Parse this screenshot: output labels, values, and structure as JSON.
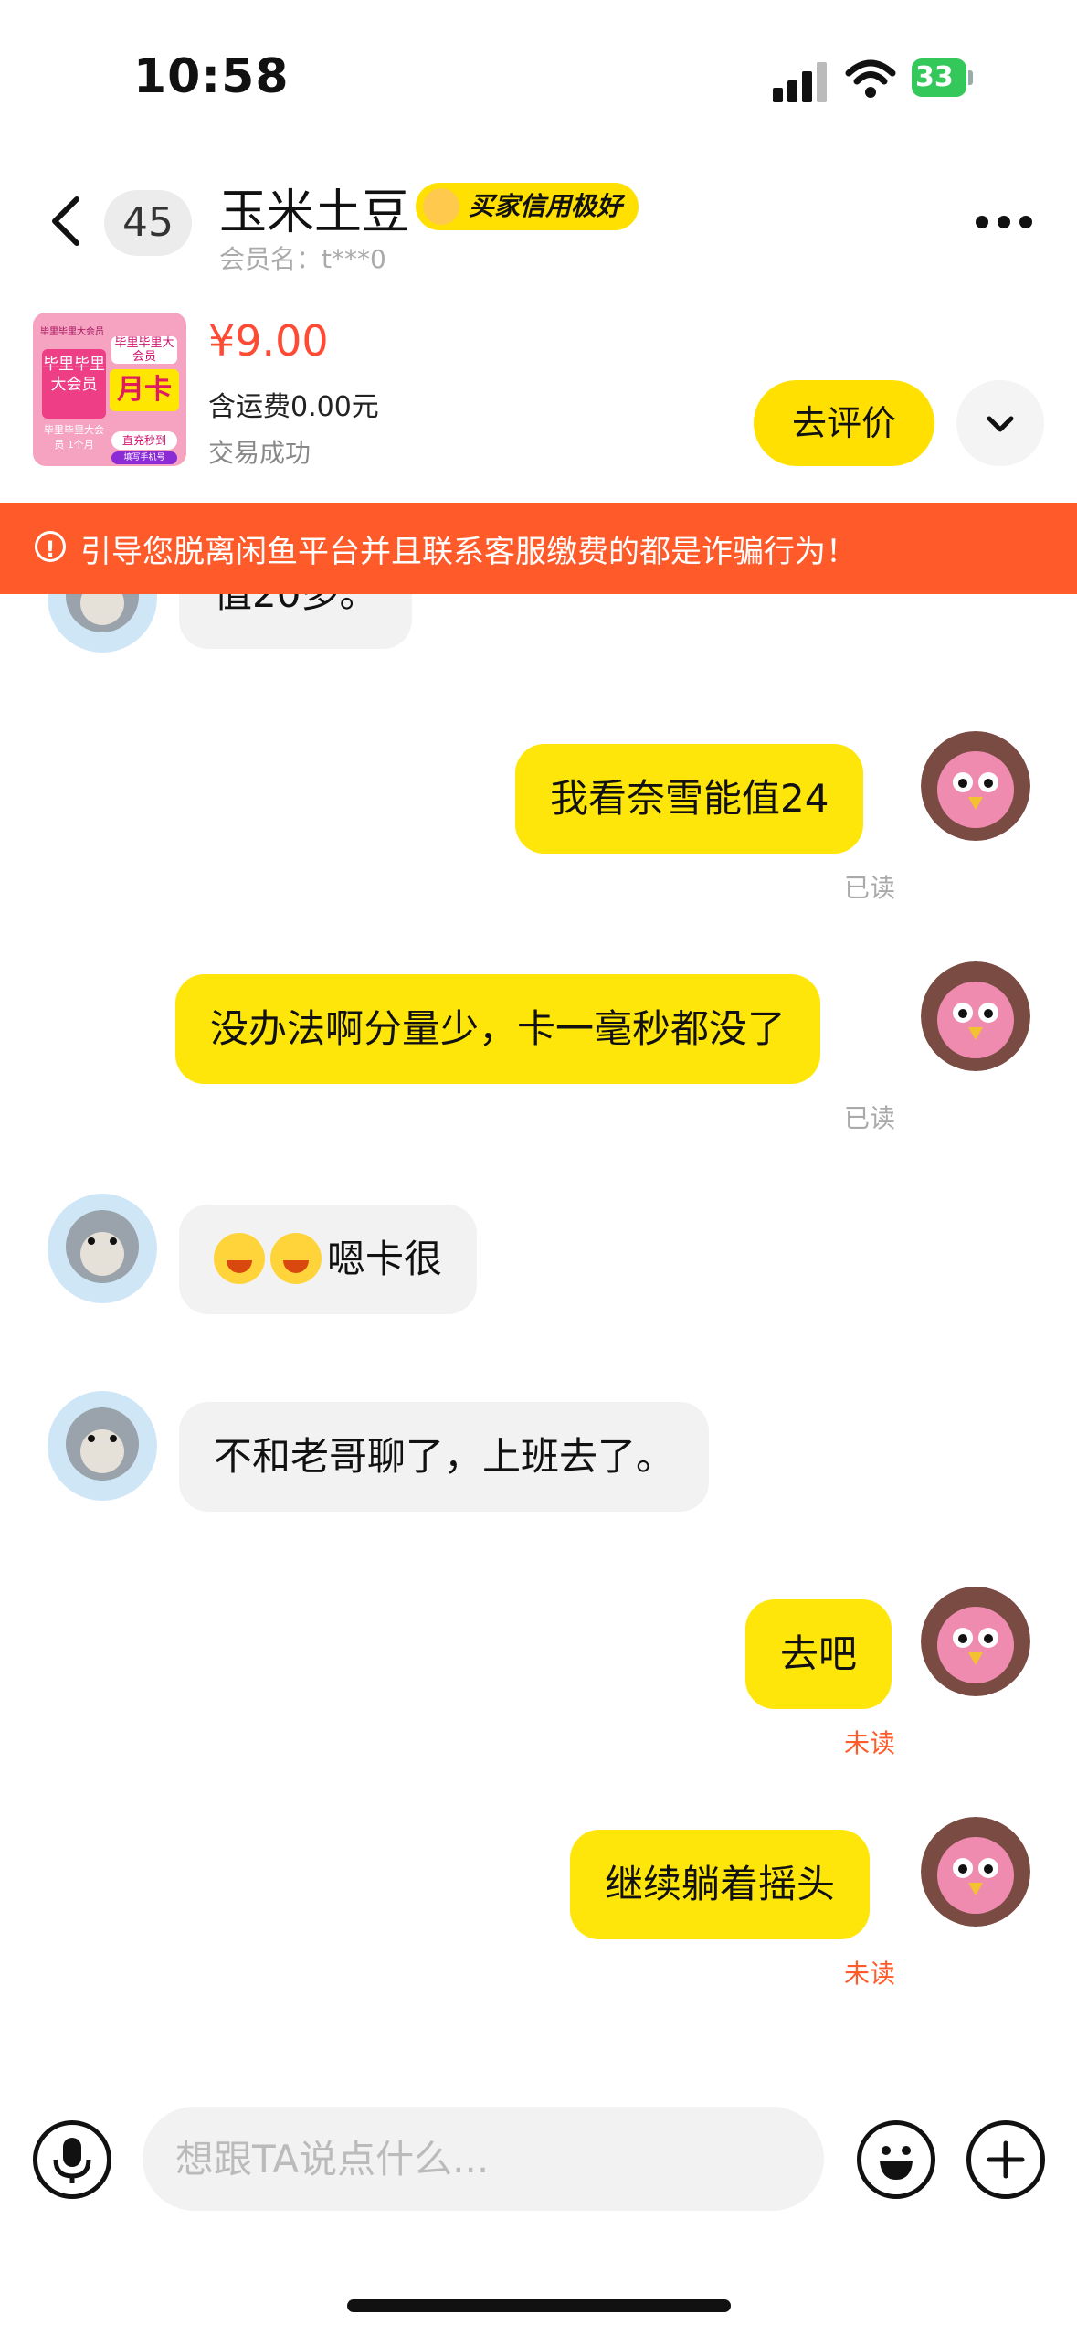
{
  "status_bar": {
    "time": "10:58",
    "battery": "33"
  },
  "header": {
    "unread_count": "45",
    "name": "玉米土豆",
    "badge": "买家信用极好",
    "member_label": "会员名：t***0"
  },
  "product": {
    "thumb": {
      "top": "毕里毕里大会员",
      "left": "毕里毕里大会员",
      "right": "毕里毕里大会员",
      "month": "月卡",
      "sub": "毕里毕里大会员 1个月",
      "button": "直充秒到",
      "foot": "填写手机号"
    },
    "price": "¥9.00",
    "shipping": "含运费0.00元",
    "status": "交易成功",
    "review_button": "去评价"
  },
  "warning": "引导您脱离闲鱼平台并且联系客服缴费的都是诈骗行为！",
  "messages": {
    "m0": "值20多。",
    "m1": "我看奈雪能值24",
    "m1_status": "已读",
    "m2": "没办法啊分量少，卡一毫秒都没了",
    "m2_status": "已读",
    "m3": "嗯卡很",
    "m4": "不和老哥聊了，上班去了。",
    "m5": "去吧",
    "m5_status": "未读",
    "m6": "继续躺着摇头",
    "m6_status": "未读"
  },
  "input": {
    "placeholder": "想跟TA说点什么..."
  },
  "colors": {
    "accent_yellow": "#ffe60a",
    "warning_orange": "#ff5a2a",
    "price_red": "#ff4a34",
    "battery_green": "#34c759"
  },
  "icons": {
    "back": "chevron-left-icon",
    "more": "more-dots-icon",
    "expand": "chevron-down-icon",
    "warning": "exclamation-circle-icon",
    "mic": "microphone-icon",
    "emoji": "smiley-icon",
    "plus": "plus-icon"
  }
}
